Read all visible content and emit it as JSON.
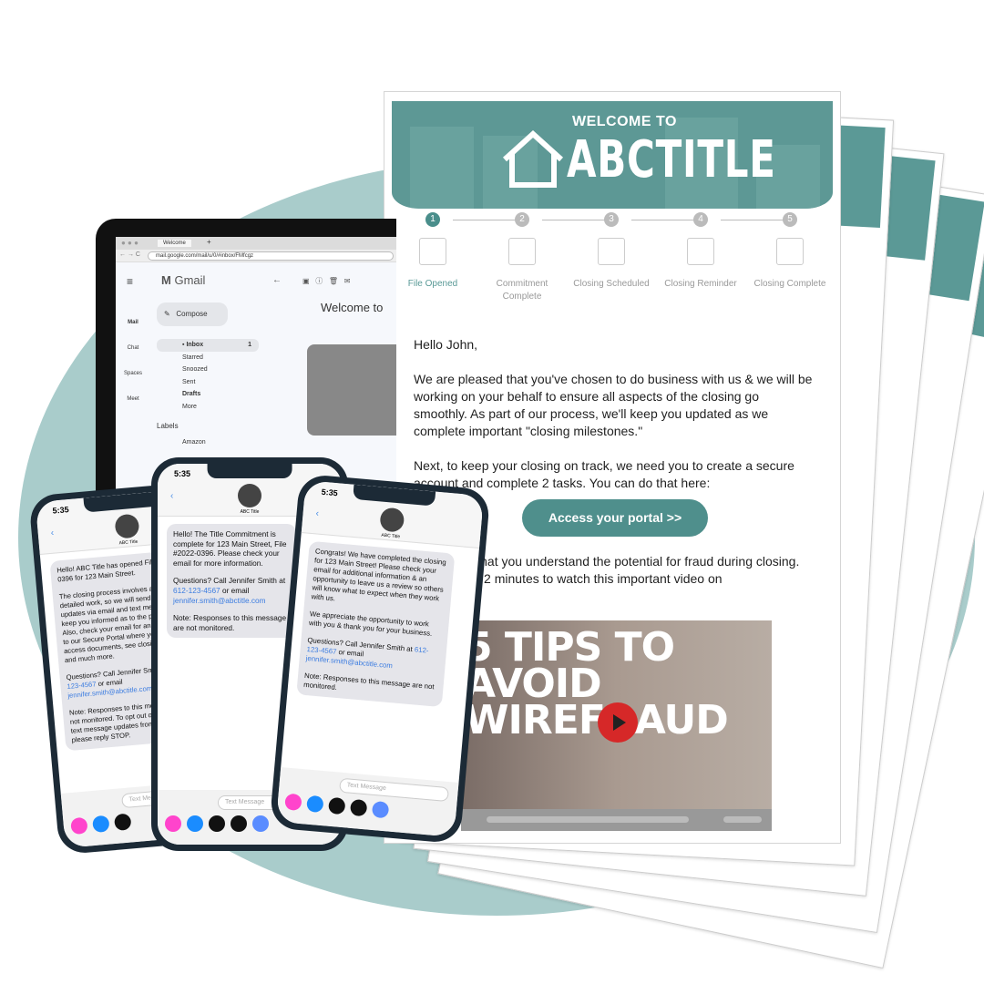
{
  "email": {
    "welcome": "WELCOME TO",
    "brand": "ABCTITLE",
    "steps": [
      {
        "num": "1",
        "label": "File Opened",
        "active": true
      },
      {
        "num": "2",
        "label": "Commitment Complete",
        "active": false
      },
      {
        "num": "3",
        "label": "Closing Scheduled",
        "active": false
      },
      {
        "num": "4",
        "label": "Closing Reminder",
        "active": false
      },
      {
        "num": "5",
        "label": "Closing Complete",
        "active": false
      }
    ],
    "greeting": "Hello John,",
    "para1": "We are pleased that you've chosen to do business with us & we will be working on your behalf to ensure all aspects of the closing go smoothly. As part of our process, we'll keep you updated as we complete important \"closing milestones.\"",
    "para2": "Next, to keep your closing on track, we need you to create a secure account and complete 2 tasks. You can do that here:",
    "portal_button": "Access your portal  >>",
    "para3": "It is critical that you understand the potential for fraud during closing. Please take 2 minutes to watch this important video on",
    "video_title": "5 TIPS TO AVOID WIREFRAUD",
    "accent": "#5d9895"
  },
  "gmail": {
    "tab": "Welcome",
    "url": "mail.google.com/mail/u/0/#inbox/FMfcgz",
    "app": "Gmail",
    "compose": "Compose",
    "subject": "Welcome to",
    "rail": [
      "Mail",
      "Chat",
      "Spaces",
      "Meet"
    ],
    "mail_badge": "1",
    "folders": [
      {
        "label": "Inbox",
        "count": "1"
      },
      {
        "label": "Starred",
        "count": ""
      },
      {
        "label": "Snoozed",
        "count": ""
      },
      {
        "label": "Sent",
        "count": ""
      },
      {
        "label": "Drafts",
        "count": ""
      },
      {
        "label": "More",
        "count": ""
      }
    ],
    "labels_title": "Labels",
    "labels": [
      "Amazon"
    ]
  },
  "phones": [
    {
      "time": "5:35",
      "contact": "ABC Title",
      "input_placeholder": "Text Message",
      "text1": "Hello! ABC Title has opened File #2022-0396 for 123 Main Street.",
      "text2": "The closing process involves a lot of detailed work, so we will send you updates via email and text messages to keep you informed as to the progress. Also, check your email for an invitation to our Secure Portal where you can access documents, see closing updates and much more.",
      "q": "Questions? Call Jennifer Smith at",
      "phone": "612-123-4567",
      "or": "or email",
      "email": "jennifer.smith@abctitle.com",
      "note": "Note: Responses to this message are not monitored. To opt out of receiving text message updates from ABC Title please reply STOP."
    },
    {
      "time": "5:35",
      "contact": "ABC Title",
      "input_placeholder": "Text Message",
      "text1": "Hello! The Title Commitment is complete for 123 Main Street, File #2022-0396. Please check your email for more information.",
      "q": "Questions? Call Jennifer Smith at",
      "phone": "612-123-4567",
      "or": "or email",
      "email": "jennifer.smith@abctitle.com",
      "note": "Note: Responses to this message are not monitored."
    },
    {
      "time": "5:35",
      "contact": "ABC Title",
      "input_placeholder": "Text Message",
      "text1": "Congrats! We have completed the closing for 123 Main Street! Please check your email for additional information & an opportunity to leave us a review so others will know what to expect when they work with us.",
      "text2": "We appreciate the opportunity to work with you & thank you for your business.",
      "q": "Questions? Call Jennifer Smith at",
      "phone": "612-123-4567",
      "or": "or email",
      "email": "jennifer.smith@abctitle.com",
      "note": "Note: Responses to this message are not monitored."
    }
  ]
}
